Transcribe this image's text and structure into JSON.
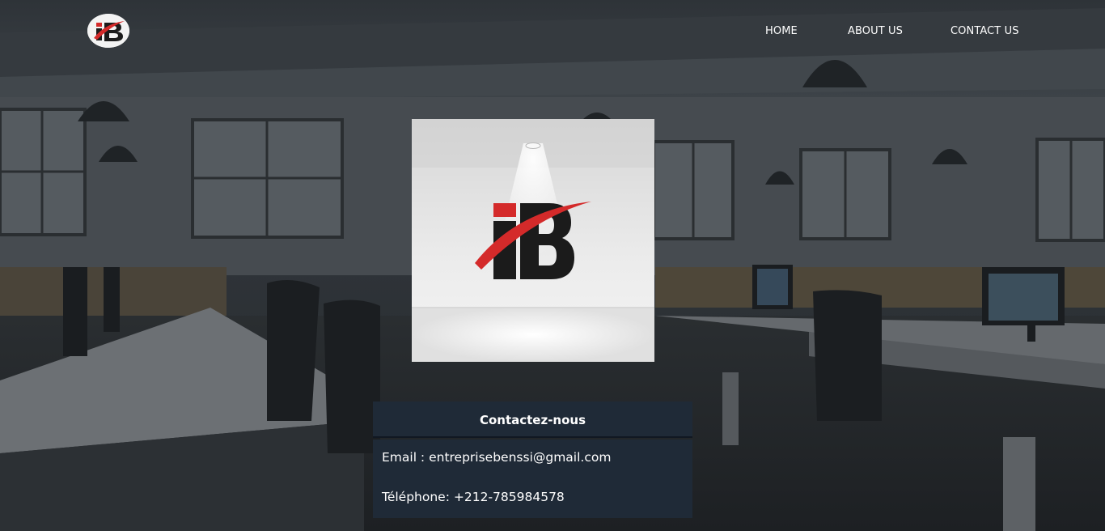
{
  "header": {
    "logo_text": "iB",
    "nav": [
      {
        "label": "HOME"
      },
      {
        "label": "ABOUT US"
      },
      {
        "label": "CONTACT US"
      }
    ]
  },
  "hero": {
    "logo_text": "iB"
  },
  "contact": {
    "title": "Contactez-nous",
    "email_line": "Email : entreprisebenssi@gmail.com",
    "phone_line": "Téléphone: +212-785984578"
  },
  "colors": {
    "brand_red": "#d42a2a",
    "brand_black": "#1b1b1b",
    "panel_bg": "#1f2a37",
    "text_white": "#ffffff"
  },
  "icons": {
    "site_logo": "ib-logo-icon",
    "hero_logo": "ib-logo-icon"
  }
}
